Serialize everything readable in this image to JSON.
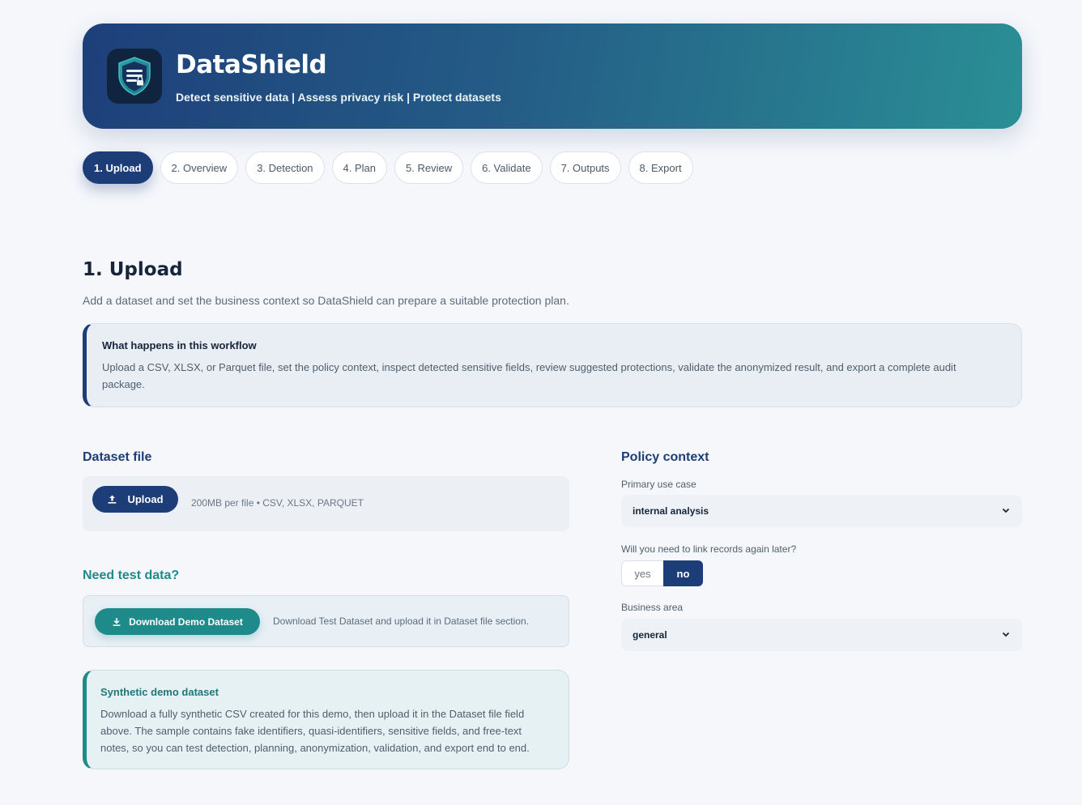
{
  "header": {
    "title": "DataShield",
    "subtitle": "Detect sensitive data | Assess privacy risk | Protect datasets",
    "logo_icon": "shield-document-lock-icon"
  },
  "tabs": [
    {
      "label": "1. Upload",
      "active": true
    },
    {
      "label": "2. Overview"
    },
    {
      "label": "3. Detection"
    },
    {
      "label": "4. Plan"
    },
    {
      "label": "5. Review"
    },
    {
      "label": "6. Validate"
    },
    {
      "label": "7. Outputs"
    },
    {
      "label": "8. Export"
    }
  ],
  "page": {
    "title": "1. Upload",
    "description": "Add a dataset and set the business context so DataShield can prepare a suitable protection plan."
  },
  "workflow_note": {
    "title": "What happens in this workflow",
    "body": "Upload a CSV, XLSX, or Parquet file, set the policy context, inspect detected sensitive fields, review suggested protections, validate the anonymized result, and export a complete audit package."
  },
  "dataset_file": {
    "heading": "Dataset file",
    "upload_label": "Upload",
    "upload_hint": "200MB per file • CSV, XLSX, PARQUET"
  },
  "test_data": {
    "heading": "Need test data?",
    "button_label": "Download Demo Dataset",
    "hint": "Download Test Dataset and upload it in Dataset file section."
  },
  "synthetic_note": {
    "title": "Synthetic demo dataset",
    "body": "Download a fully synthetic CSV created for this demo, then upload it in the Dataset file field above. The sample contains fake identifiers, quasi-identifiers, sensitive fields, and free-text notes, so you can test detection, planning, anonymization, validation, and export end to end."
  },
  "policy": {
    "heading": "Policy context",
    "use_case_label": "Primary use case",
    "use_case_value": "internal analysis",
    "link_label": "Will you need to link records again later?",
    "link_options": [
      "yes",
      "no"
    ],
    "link_selected": "no",
    "area_label": "Business area",
    "area_value": "general"
  },
  "colors": {
    "primary": "#1d3d78",
    "teal": "#1f8a8a",
    "background": "#f5f7fb"
  }
}
